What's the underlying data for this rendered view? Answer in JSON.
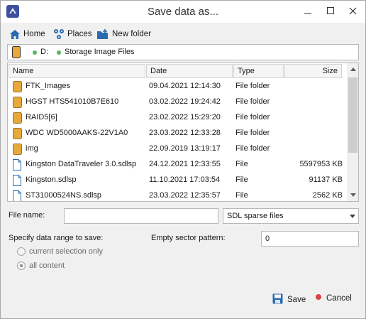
{
  "window": {
    "title": "Save data as...",
    "controls": [
      "minimize",
      "maximize",
      "close"
    ]
  },
  "toolbar": {
    "home_label": "Home",
    "places_label": "Places",
    "new_folder_label": "New folder"
  },
  "path": {
    "segments": [
      "D:",
      "Storage Image Files"
    ]
  },
  "file_list": {
    "columns": [
      "Name",
      "Date",
      "Type",
      "Size"
    ],
    "rows": [
      {
        "icon": "folder-icon",
        "name": "FTK_Images",
        "date": "09.04.2021 12:14:30",
        "type": "File folder",
        "size": ""
      },
      {
        "icon": "folder-icon",
        "name": "HGST HTS541010B7E610",
        "date": "03.02.2022 19:24:42",
        "type": "File folder",
        "size": ""
      },
      {
        "icon": "folder-icon",
        "name": "RAID5[6]",
        "date": "23.02.2022 15:29:20",
        "type": "File folder",
        "size": ""
      },
      {
        "icon": "folder-icon",
        "name": "WDC WD5000AAKS-22V1A0",
        "date": "23.03.2022 12:33:28",
        "type": "File folder",
        "size": ""
      },
      {
        "icon": "folder-icon",
        "name": "img",
        "date": "22.09.2019 13:19:17",
        "type": "File folder",
        "size": ""
      },
      {
        "icon": "file-icon",
        "name": "Kingston DataTraveler 3.0.sdlsp",
        "date": "24.12.2021 12:33:55",
        "type": "File",
        "size": "5597953 KB"
      },
      {
        "icon": "file-icon",
        "name": "Kingston.sdlsp",
        "date": "11.10.2021 17:03:54",
        "type": "File",
        "size": "91137 KB"
      },
      {
        "icon": "file-icon",
        "name": "ST31000524NS.sdlsp",
        "date": "23.03.2022 12:35:57",
        "type": "File",
        "size": "2562 KB"
      }
    ]
  },
  "form": {
    "file_name_label": "File name:",
    "file_name_value": "",
    "file_type_value": "SDL sparse files",
    "range_label": "Specify data range to save:",
    "pattern_label": "Empty sector pattern:",
    "pattern_value": "0",
    "radio_selection": "current selection only",
    "radio_all": "all content",
    "selected_radio": "all content"
  },
  "footer": {
    "save_label": "Save",
    "cancel_label": "Cancel"
  },
  "colors": {
    "folder": "#e8a93a",
    "accent_blue": "#2a6bb0",
    "cancel_red": "#d9434a",
    "path_dot": "#5ab55a"
  }
}
